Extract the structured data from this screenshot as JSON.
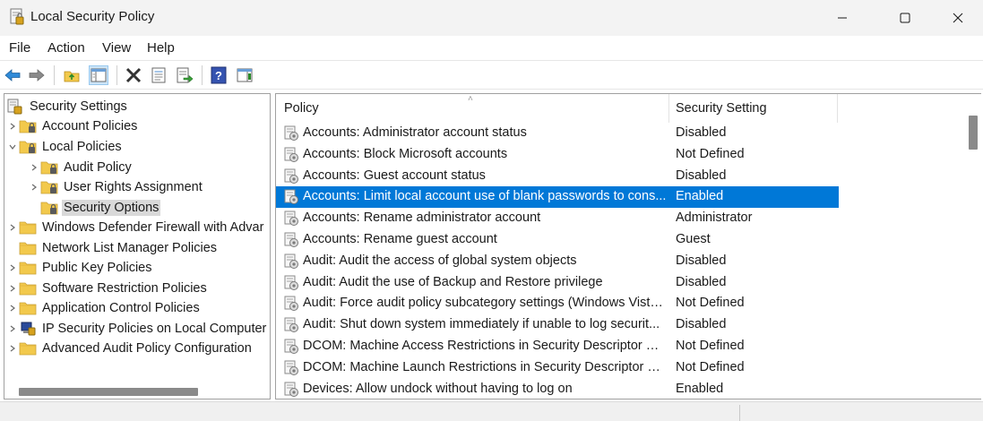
{
  "window": {
    "title": "Local Security Policy",
    "icon": "local-security-policy-icon"
  },
  "menu": [
    "File",
    "Action",
    "View",
    "Help"
  ],
  "toolbar": {
    "buttons": [
      "back-icon",
      "forward-icon",
      "up-folder-icon",
      "show-hide-tree-icon",
      "delete-icon",
      "properties-icon",
      "export-list-icon",
      "help-icon",
      "show-hide-action-pane-icon"
    ]
  },
  "tree": {
    "root": "Security Settings",
    "items": [
      {
        "label": "Account Policies",
        "level": 1,
        "expandable": true,
        "expanded": false
      },
      {
        "label": "Local Policies",
        "level": 1,
        "expandable": true,
        "expanded": true
      },
      {
        "label": "Audit Policy",
        "level": 2,
        "expandable": true,
        "expanded": false
      },
      {
        "label": "User Rights Assignment",
        "level": 2,
        "expandable": true,
        "expanded": false
      },
      {
        "label": "Security Options",
        "level": 2,
        "expandable": false,
        "selected": true
      },
      {
        "label": "Windows Defender Firewall with Advar",
        "level": 1,
        "expandable": true,
        "expanded": false
      },
      {
        "label": "Network List Manager Policies",
        "level": 1,
        "expandable": false
      },
      {
        "label": "Public Key Policies",
        "level": 1,
        "expandable": true,
        "expanded": false
      },
      {
        "label": "Software Restriction Policies",
        "level": 1,
        "expandable": true,
        "expanded": false
      },
      {
        "label": "Application Control Policies",
        "level": 1,
        "expandable": true,
        "expanded": false
      },
      {
        "label": "IP Security Policies on Local Computer",
        "level": 1,
        "expandable": true,
        "expanded": false
      },
      {
        "label": "Advanced Audit Policy Configuration",
        "level": 1,
        "expandable": true,
        "expanded": false
      }
    ]
  },
  "list": {
    "columns": [
      "Policy",
      "Security Setting"
    ],
    "rows": [
      {
        "policy": "Accounts: Administrator account status",
        "setting": "Disabled"
      },
      {
        "policy": "Accounts: Block Microsoft accounts",
        "setting": "Not Defined"
      },
      {
        "policy": "Accounts: Guest account status",
        "setting": "Disabled"
      },
      {
        "policy": "Accounts: Limit local account use of blank passwords to cons...",
        "setting": "Enabled",
        "selected": true
      },
      {
        "policy": "Accounts: Rename administrator account",
        "setting": "Administrator"
      },
      {
        "policy": "Accounts: Rename guest account",
        "setting": "Guest"
      },
      {
        "policy": "Audit: Audit the access of global system objects",
        "setting": "Disabled"
      },
      {
        "policy": "Audit: Audit the use of Backup and Restore privilege",
        "setting": "Disabled"
      },
      {
        "policy": "Audit: Force audit policy subcategory settings (Windows Vista...",
        "setting": "Not Defined"
      },
      {
        "policy": "Audit: Shut down system immediately if unable to log securit...",
        "setting": "Disabled"
      },
      {
        "policy": "DCOM: Machine Access Restrictions in Security Descriptor Def...",
        "setting": "Not Defined"
      },
      {
        "policy": "DCOM: Machine Launch Restrictions in Security Descriptor De...",
        "setting": "Not Defined"
      },
      {
        "policy": "Devices: Allow undock without having to log on",
        "setting": "Enabled"
      }
    ]
  },
  "colors": {
    "selection": "#0078d7",
    "tree_selection": "#d9d9d9",
    "folder": "#f2c94c"
  }
}
